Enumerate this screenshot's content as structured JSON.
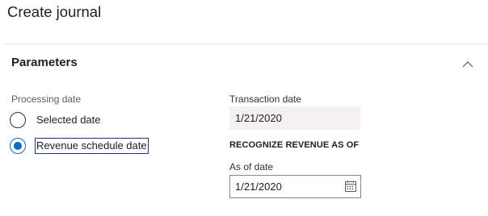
{
  "dialog": {
    "title": "Create journal"
  },
  "parameters": {
    "title": "Parameters",
    "collapse_icon": "chevron-up-icon",
    "processing_date": {
      "label": "Processing date",
      "options": [
        {
          "label": "Selected date",
          "checked": false
        },
        {
          "label": "Revenue schedule date",
          "checked": true
        }
      ]
    },
    "transaction_date": {
      "label": "Transaction date",
      "value": "1/21/2020"
    },
    "recognize_section": {
      "title": "RECOGNIZE REVENUE AS OF"
    },
    "as_of_date": {
      "label": "As of date",
      "value": "1/21/2020",
      "icon": "calendar-icon"
    }
  },
  "colors": {
    "accent": "#0f6cbd",
    "focus_border": "#1a3b73",
    "readonly_bg": "#f3f2f1",
    "divider": "#edebe9"
  }
}
